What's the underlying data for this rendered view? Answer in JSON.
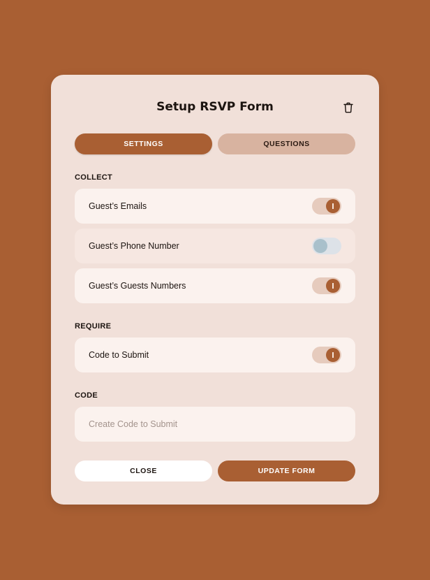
{
  "modal": {
    "title": "Setup RSVP Form",
    "trash_icon": "trash-icon"
  },
  "tabs": [
    {
      "label": "SETTINGS",
      "active": true
    },
    {
      "label": "QUESTIONS",
      "active": false
    }
  ],
  "collect": {
    "label": "COLLECT",
    "items": [
      {
        "label": "Guest’s Emails",
        "enabled": true
      },
      {
        "label": "Guest’s Phone Number",
        "enabled": false
      },
      {
        "label": "Guest’s Guests Numbers",
        "enabled": true
      }
    ]
  },
  "require": {
    "label": "REQUIRE",
    "items": [
      {
        "label": "Code to Submit",
        "enabled": true
      }
    ]
  },
  "code": {
    "label": "CODE",
    "value": "",
    "placeholder": "Create Code to Submit"
  },
  "actions": {
    "close_label": "CLOSE",
    "update_label": "UPDATE FORM"
  },
  "colors": {
    "background": "#a95f33",
    "accent": "#a95f33",
    "modal": "#f1e0d9",
    "tab_inactive": "#d8b3a0"
  }
}
